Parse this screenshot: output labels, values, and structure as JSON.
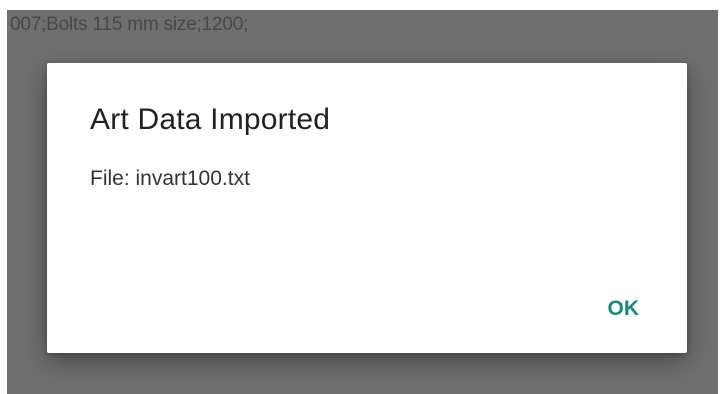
{
  "background": {
    "text": "007;Bolts 115 mm size;1200;"
  },
  "dialog": {
    "title": "Art Data Imported",
    "message": "File: invart100.txt",
    "ok_label": "OK"
  },
  "colors": {
    "scrim": "#6f6f6f",
    "dialog_background": "#ffffff",
    "accent": "#1a8a7a"
  }
}
